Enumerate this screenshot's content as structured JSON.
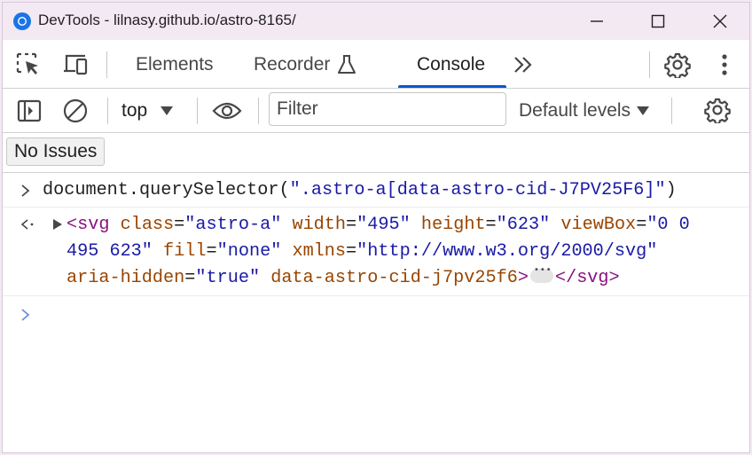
{
  "window": {
    "title": "DevTools - lilnasy.github.io/astro-8165/"
  },
  "tabs": [
    {
      "label": "Elements",
      "active": false
    },
    {
      "label": "Recorder",
      "active": false
    },
    {
      "label": "Console",
      "active": true
    }
  ],
  "console_toolbar": {
    "context": "top",
    "filter_placeholder": "Filter",
    "levels": "Default levels"
  },
  "issues": {
    "label": "No Issues"
  },
  "console": {
    "input": {
      "prefix": "document.querySelector(",
      "arg": "\".astro-a[data-astro-cid-J7PV25F6]\"",
      "suffix": ")"
    },
    "result": {
      "line1": {
        "open": "<svg",
        "a1": "class",
        "v1": "\"astro-a\"",
        "a2": "width",
        "v2": "\"495\"",
        "a3": "height",
        "v3": "\"623\"",
        "a4": "viewBox",
        "v4a": "\"0 0"
      },
      "line2": {
        "v4b": "495 623\"",
        "a5": "fill",
        "v5": "\"none\"",
        "a6": "xmlns",
        "v6": "\"http://www.w3.org/2000/svg\""
      },
      "line3": {
        "a7": "aria-hidden",
        "v7": "\"true\"",
        "a8": "data-astro-cid-j7pv25f6",
        "close_open": ">",
        "close": "</svg>"
      }
    }
  },
  "colors": {
    "accent": "#0b57d0",
    "tag": "#881280",
    "attribute": "#994500",
    "value": "#1a1aa6"
  }
}
